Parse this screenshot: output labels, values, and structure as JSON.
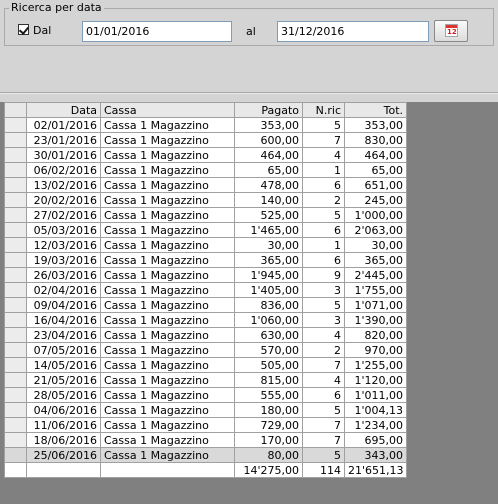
{
  "filter": {
    "legend": "Ricerca per data",
    "dal_label": "Dal",
    "dal_checked": true,
    "date_from": "01/01/2016",
    "al_label": "al",
    "date_to": "31/12/2016",
    "calendar_icon_text": "12"
  },
  "table": {
    "headers": {
      "data": "Data",
      "cassa": "Cassa",
      "pagato": "Pagato",
      "nric": "N.ric",
      "tot": "Tot."
    },
    "rows": [
      {
        "data": "02/01/2016",
        "cassa": "Cassa 1 Magazzino",
        "pagato": "353,00",
        "nric": "5",
        "tot": "353,00"
      },
      {
        "data": "23/01/2016",
        "cassa": "Cassa 1 Magazzino",
        "pagato": "600,00",
        "nric": "7",
        "tot": "830,00"
      },
      {
        "data": "30/01/2016",
        "cassa": "Cassa 1 Magazzino",
        "pagato": "464,00",
        "nric": "4",
        "tot": "464,00"
      },
      {
        "data": "06/02/2016",
        "cassa": "Cassa 1 Magazzino",
        "pagato": "65,00",
        "nric": "1",
        "tot": "65,00"
      },
      {
        "data": "13/02/2016",
        "cassa": "Cassa 1 Magazzino",
        "pagato": "478,00",
        "nric": "6",
        "tot": "651,00"
      },
      {
        "data": "20/02/2016",
        "cassa": "Cassa 1 Magazzino",
        "pagato": "140,00",
        "nric": "2",
        "tot": "245,00"
      },
      {
        "data": "27/02/2016",
        "cassa": "Cassa 1 Magazzino",
        "pagato": "525,00",
        "nric": "5",
        "tot": "1'000,00"
      },
      {
        "data": "05/03/2016",
        "cassa": "Cassa 1 Magazzino",
        "pagato": "1'465,00",
        "nric": "6",
        "tot": "2'063,00"
      },
      {
        "data": "12/03/2016",
        "cassa": "Cassa 1 Magazzino",
        "pagato": "30,00",
        "nric": "1",
        "tot": "30,00"
      },
      {
        "data": "19/03/2016",
        "cassa": "Cassa 1 Magazzino",
        "pagato": "365,00",
        "nric": "6",
        "tot": "365,00"
      },
      {
        "data": "26/03/2016",
        "cassa": "Cassa 1 Magazzino",
        "pagato": "1'945,00",
        "nric": "9",
        "tot": "2'445,00"
      },
      {
        "data": "02/04/2016",
        "cassa": "Cassa 1 Magazzino",
        "pagato": "1'405,00",
        "nric": "3",
        "tot": "1'755,00"
      },
      {
        "data": "09/04/2016",
        "cassa": "Cassa 1 Magazzino",
        "pagato": "836,00",
        "nric": "5",
        "tot": "1'071,00"
      },
      {
        "data": "16/04/2016",
        "cassa": "Cassa 1 Magazzino",
        "pagato": "1'060,00",
        "nric": "3",
        "tot": "1'390,00"
      },
      {
        "data": "23/04/2016",
        "cassa": "Cassa 1 Magazzino",
        "pagato": "630,00",
        "nric": "4",
        "tot": "820,00"
      },
      {
        "data": "07/05/2016",
        "cassa": "Cassa 1 Magazzino",
        "pagato": "570,00",
        "nric": "2",
        "tot": "970,00"
      },
      {
        "data": "14/05/2016",
        "cassa": "Cassa 1 Magazzino",
        "pagato": "505,00",
        "nric": "7",
        "tot": "1'255,00"
      },
      {
        "data": "21/05/2016",
        "cassa": "Cassa 1 Magazzino",
        "pagato": "815,00",
        "nric": "4",
        "tot": "1'120,00"
      },
      {
        "data": "28/05/2016",
        "cassa": "Cassa 1 Magazzino",
        "pagato": "555,00",
        "nric": "6",
        "tot": "1'011,00"
      },
      {
        "data": "04/06/2016",
        "cassa": "Cassa 1 Magazzino",
        "pagato": "180,00",
        "nric": "5",
        "tot": "1'004,13"
      },
      {
        "data": "11/06/2016",
        "cassa": "Cassa 1 Magazzino",
        "pagato": "729,00",
        "nric": "7",
        "tot": "1'234,00"
      },
      {
        "data": "18/06/2016",
        "cassa": "Cassa 1 Magazzino",
        "pagato": "170,00",
        "nric": "7",
        "tot": "695,00"
      },
      {
        "data": "25/06/2016",
        "cassa": "Cassa 1 Magazzino",
        "pagato": "80,00",
        "nric": "5",
        "tot": "343,00"
      }
    ],
    "selected_row_index": 22,
    "totals": {
      "data": "",
      "cassa": "",
      "pagato": "14'275,00",
      "nric": "114",
      "tot": "21'651,13"
    }
  },
  "colors": {
    "window_bg": "#d4d4d4",
    "grid_bg": "#808080",
    "header_bg": "#e8e8e8",
    "selected_row_bg": "#d9d9d9",
    "input_border": "#7f9db9"
  }
}
